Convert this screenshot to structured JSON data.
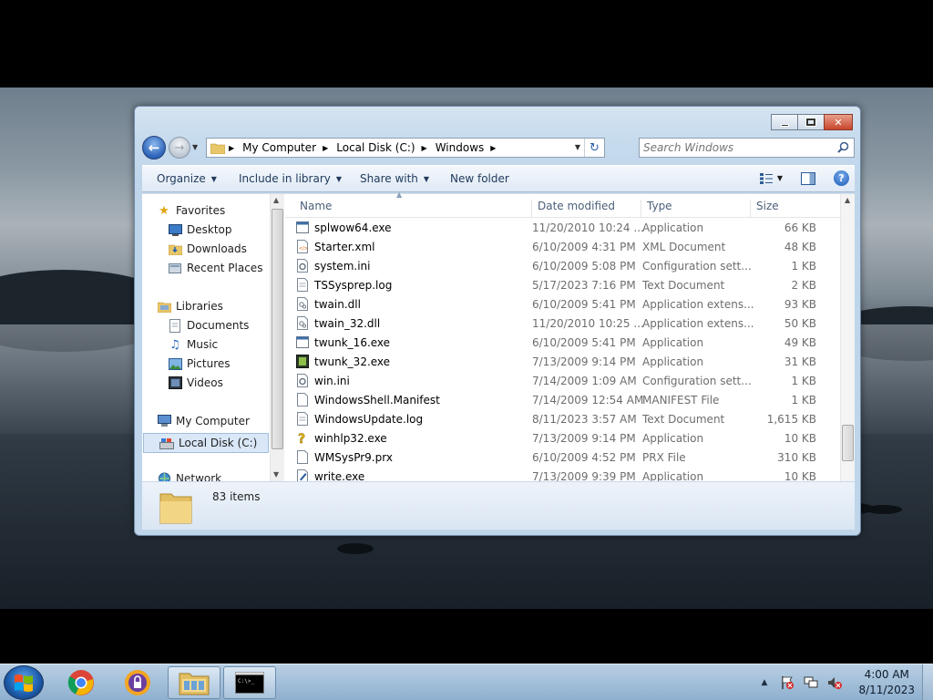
{
  "window": {
    "caption": {
      "minimize": "—",
      "maximize": "□",
      "close": "✕"
    },
    "address": {
      "crumbs": [
        "My Computer",
        "Local Disk (C:)",
        "Windows"
      ]
    },
    "search": {
      "placeholder": "Search Windows"
    },
    "toolbar": {
      "organize": "Organize",
      "include": "Include in library",
      "share": "Share with",
      "new_folder": "New folder"
    },
    "nav": {
      "favorites": "Favorites",
      "desktop": "Desktop",
      "downloads": "Downloads",
      "recent": "Recent Places",
      "libraries": "Libraries",
      "documents": "Documents",
      "music": "Music",
      "pictures": "Pictures",
      "videos": "Videos",
      "computer": "My Computer",
      "local_disk": "Local Disk (C:)",
      "network": "Network"
    },
    "columns": {
      "name": "Name",
      "date": "Date modified",
      "type": "Type",
      "size": "Size"
    },
    "files": [
      {
        "name": "splwow64.exe",
        "date": "11/20/2010 10:24 ...",
        "type": "Application",
        "size": "66 KB",
        "icon": "app-icon"
      },
      {
        "name": "Starter.xml",
        "date": "6/10/2009 4:31 PM",
        "type": "XML Document",
        "size": "48 KB",
        "icon": "xml-icon"
      },
      {
        "name": "system.ini",
        "date": "6/10/2009 5:08 PM",
        "type": "Configuration sett...",
        "size": "1 KB",
        "icon": "config-icon"
      },
      {
        "name": "TSSysprep.log",
        "date": "5/17/2023 7:16 PM",
        "type": "Text Document",
        "size": "2 KB",
        "icon": "text-icon"
      },
      {
        "name": "twain.dll",
        "date": "6/10/2009 5:41 PM",
        "type": "Application extens...",
        "size": "93 KB",
        "icon": "dll-icon"
      },
      {
        "name": "twain_32.dll",
        "date": "11/20/2010 10:25 ...",
        "type": "Application extens...",
        "size": "50 KB",
        "icon": "dll-icon"
      },
      {
        "name": "twunk_16.exe",
        "date": "6/10/2009 5:41 PM",
        "type": "Application",
        "size": "49 KB",
        "icon": "app-icon"
      },
      {
        "name": "twunk_32.exe",
        "date": "7/13/2009 9:14 PM",
        "type": "Application",
        "size": "31 KB",
        "icon": "twunk-icon"
      },
      {
        "name": "win.ini",
        "date": "7/14/2009 1:09 AM",
        "type": "Configuration sett...",
        "size": "1 KB",
        "icon": "config-icon"
      },
      {
        "name": "WindowsShell.Manifest",
        "date": "7/14/2009 12:54 AM",
        "type": "MANIFEST File",
        "size": "1 KB",
        "icon": "blank-file-icon"
      },
      {
        "name": "WindowsUpdate.log",
        "date": "8/11/2023 3:57 AM",
        "type": "Text Document",
        "size": "1,615 KB",
        "icon": "text-icon"
      },
      {
        "name": "winhlp32.exe",
        "date": "7/13/2009 9:14 PM",
        "type": "Application",
        "size": "10 KB",
        "icon": "help-file-icon"
      },
      {
        "name": "WMSysPr9.prx",
        "date": "6/10/2009 4:52 PM",
        "type": "PRX File",
        "size": "310 KB",
        "icon": "blank-file-icon"
      },
      {
        "name": "write.exe",
        "date": "7/13/2009 9:39 PM",
        "type": "Application",
        "size": "10 KB",
        "icon": "write-icon"
      }
    ],
    "status": {
      "count": "83 items"
    }
  },
  "taskbar": {
    "apps": [
      "chrome-icon",
      "lock-app-icon",
      "explorer-icon",
      "cmd-icon"
    ],
    "cmd_text": "C:\\>_",
    "clock": {
      "time": "4:00 AM",
      "date": "8/11/2023"
    }
  }
}
